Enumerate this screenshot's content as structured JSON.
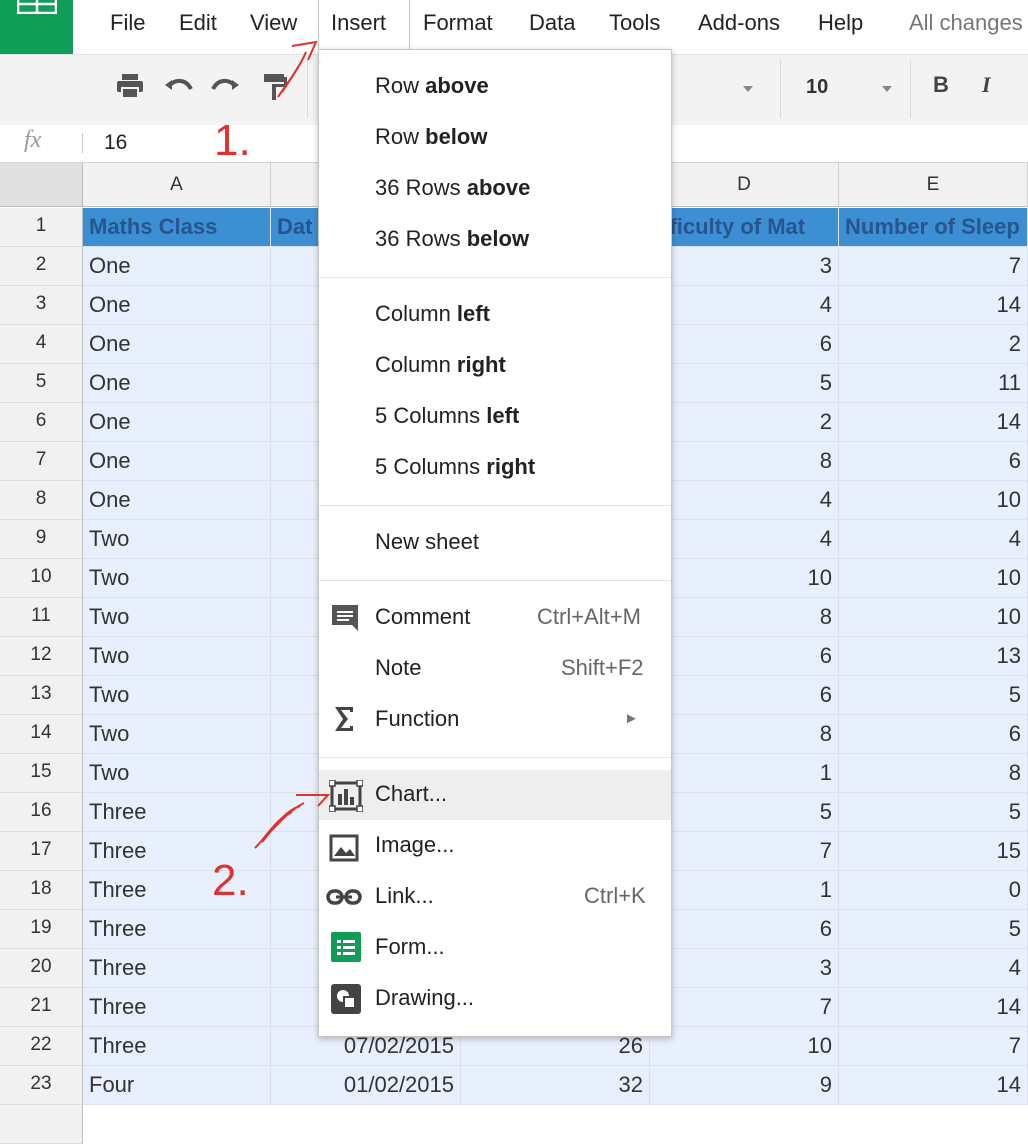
{
  "menubar": {
    "items": [
      "File",
      "Edit",
      "View",
      "Insert",
      "Format",
      "Data",
      "Tools",
      "Add-ons",
      "Help"
    ],
    "status": "All changes"
  },
  "toolbar": {
    "font_size": "10",
    "bold_label": "B",
    "italic_label": "I"
  },
  "formula_bar": {
    "fx_label": "fx",
    "value": "16"
  },
  "grid": {
    "columns": [
      "A",
      "",
      "",
      "D",
      "E"
    ],
    "header_row": {
      "num": "1",
      "a": "Maths Class",
      "b": "Dat",
      "d": "ifficulty of Mat",
      "e": "Number of Sleep"
    },
    "rows": [
      {
        "num": "2",
        "a": "One",
        "d": "3",
        "e": "7"
      },
      {
        "num": "3",
        "a": "One",
        "d": "4",
        "e": "14"
      },
      {
        "num": "4",
        "a": "One",
        "d": "6",
        "e": "2"
      },
      {
        "num": "5",
        "a": "One",
        "d": "5",
        "e": "11"
      },
      {
        "num": "6",
        "a": "One",
        "d": "2",
        "e": "14"
      },
      {
        "num": "7",
        "a": "One",
        "d": "8",
        "e": "6"
      },
      {
        "num": "8",
        "a": "One",
        "d": "4",
        "e": "10"
      },
      {
        "num": "9",
        "a": "Two",
        "d": "4",
        "e": "4"
      },
      {
        "num": "10",
        "a": "Two",
        "d": "10",
        "e": "10"
      },
      {
        "num": "11",
        "a": "Two",
        "d": "8",
        "e": "10"
      },
      {
        "num": "12",
        "a": "Two",
        "d": "6",
        "e": "13"
      },
      {
        "num": "13",
        "a": "Two",
        "d": "6",
        "e": "5"
      },
      {
        "num": "14",
        "a": "Two",
        "d": "8",
        "e": "6"
      },
      {
        "num": "15",
        "a": "Two",
        "d": "1",
        "e": "8"
      },
      {
        "num": "16",
        "a": "Three",
        "d": "5",
        "e": "5"
      },
      {
        "num": "17",
        "a": "Three",
        "d": "7",
        "e": "15"
      },
      {
        "num": "18",
        "a": "Three",
        "d": "1",
        "e": "0"
      },
      {
        "num": "19",
        "a": "Three",
        "d": "6",
        "e": "5"
      },
      {
        "num": "20",
        "a": "Three",
        "d": "3",
        "e": "4"
      },
      {
        "num": "21",
        "a": "Three",
        "d": "7",
        "e": "14"
      },
      {
        "num": "22",
        "a": "Three",
        "b": "07/02/2015",
        "c": "26",
        "d": "10",
        "e": "7"
      },
      {
        "num": "23",
        "a": "Four",
        "b": "01/02/2015",
        "c": "32",
        "d": "9",
        "e": "14"
      }
    ]
  },
  "insert_menu": {
    "row_above": {
      "pre": "Row ",
      "bold": "above"
    },
    "row_below": {
      "pre": "Row ",
      "bold": "below"
    },
    "rows_above": {
      "pre": "36 Rows ",
      "bold": "above"
    },
    "rows_below": {
      "pre": "36 Rows ",
      "bold": "below"
    },
    "col_left": {
      "pre": "Column ",
      "bold": "left"
    },
    "col_right": {
      "pre": "Column ",
      "bold": "right"
    },
    "cols_left": {
      "pre": "5 Columns ",
      "bold": "left"
    },
    "cols_right": {
      "pre": "5 Columns ",
      "bold": "right"
    },
    "new_sheet": "New sheet",
    "comment": {
      "label": "Comment",
      "shortcut": "Ctrl+Alt+M"
    },
    "note": {
      "label": "Note",
      "shortcut": "Shift+F2"
    },
    "function": {
      "label": "Function",
      "arrow": "►"
    },
    "chart": "Chart...",
    "image": "Image...",
    "link": {
      "label": "Link...",
      "shortcut": "Ctrl+K"
    },
    "form": "Form...",
    "drawing": "Drawing..."
  },
  "annotations": {
    "step1": "1.",
    "step2": "2."
  },
  "colors": {
    "brand_green": "#0f9d58",
    "selection_fill": "#e8f0fe",
    "header_blue": "#3d8fd4",
    "annotation_red": "#e03030"
  }
}
